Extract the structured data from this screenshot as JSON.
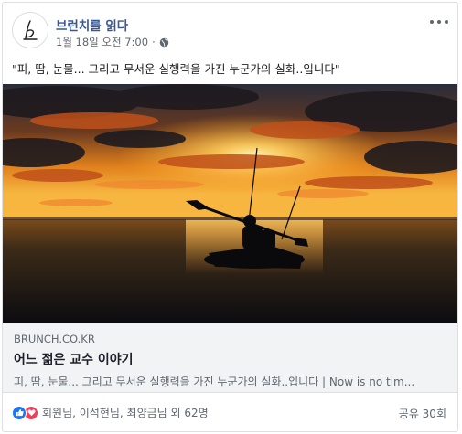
{
  "post": {
    "page_name": "브런치를 읽다",
    "timestamp": "1월 18일 오전 7:00",
    "separator": "·",
    "text": "\"피, 땀, 눈물... 그리고 무서운 실행력을 가진 누군가의 실화..입니다\""
  },
  "icons": {
    "avatar": "brunch-logo-icon",
    "audience": "globe-icon",
    "more": "more-options-icon",
    "like": "like-reaction-icon",
    "love": "love-reaction-icon"
  },
  "link_preview": {
    "domain": "BRUNCH.CO.KR",
    "title": "어느 젊은 교수 이야기",
    "description": "피, 땀, 눈물... 그리고 무서운 실행력을 가진 누군가의 실화..입니다 | Now is no tim..."
  },
  "footer": {
    "reaction_summary": "회원님, 이석현님, 최양금님 외 62명",
    "shares": "공유 30회"
  },
  "colors": {
    "link_blue": "#385898",
    "like_blue": "#1877f2",
    "love_red": "#f33e58",
    "muted_text": "#606770"
  }
}
